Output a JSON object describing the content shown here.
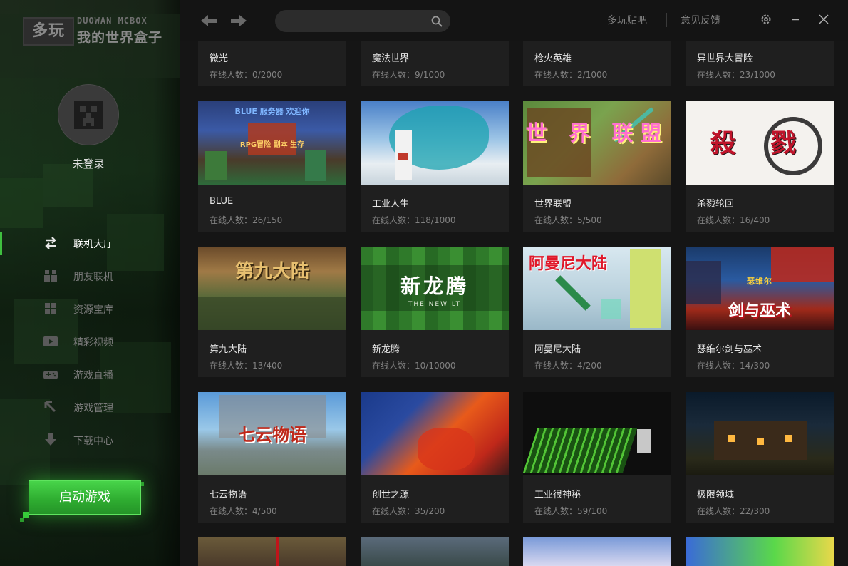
{
  "logo": {
    "mark": "多玩",
    "en": "DUOWAN MCBOX",
    "cn": "我的世界盒子"
  },
  "user": {
    "status": "未登录"
  },
  "nav": {
    "items": [
      {
        "label": "联机大厅",
        "icon": "swap-arrows-icon",
        "active": true
      },
      {
        "label": "朋友联机",
        "icon": "friends-icon",
        "active": false
      },
      {
        "label": "资源宝库",
        "icon": "grid-icon",
        "active": false
      },
      {
        "label": "精彩视频",
        "icon": "video-play-icon",
        "active": false
      },
      {
        "label": "游戏直播",
        "icon": "gamepad-icon",
        "active": false
      },
      {
        "label": "游戏管理",
        "icon": "manage-arrow-icon",
        "active": false
      },
      {
        "label": "下载中心",
        "icon": "download-icon",
        "active": false
      }
    ]
  },
  "launch": {
    "label": "启动游戏"
  },
  "topbar": {
    "search_placeholder": "",
    "link_forum": "多玩贴吧",
    "link_feedback": "意见反馈"
  },
  "servers": {
    "prefix": "在线人数：",
    "top_row": [
      {
        "name": "微光",
        "online": "0/2000"
      },
      {
        "name": "魔法世界",
        "online": "9/1000"
      },
      {
        "name": "枪火英雄",
        "online": "2/1000"
      },
      {
        "name": "异世界大冒险",
        "online": "23/1000"
      }
    ],
    "rows": [
      [
        {
          "name": "BLUE",
          "online": "26/150",
          "art": "BLUE 服务器 欢迎你",
          "art2": "RPG冒险 副本 生存"
        },
        {
          "name": "工业人生",
          "online": "118/1000",
          "art": ""
        },
        {
          "name": "世界联盟",
          "online": "5/500",
          "art": "世 界 联盟"
        },
        {
          "name": "杀戮轮回",
          "online": "16/400",
          "art": "殺 戮"
        }
      ],
      [
        {
          "name": "第九大陆",
          "online": "13/400",
          "art": "第九大陆"
        },
        {
          "name": "新龙腾",
          "online": "10/10000",
          "art": "新龙腾",
          "art2": "THE NEW LT"
        },
        {
          "name": "阿曼尼大陆",
          "online": "4/200",
          "art": "阿曼尼大陆"
        },
        {
          "name": "瑟维尔剑与巫术",
          "online": "14/300",
          "art": "剑与巫术",
          "art2": "瑟维尔"
        }
      ],
      [
        {
          "name": "七云物语",
          "online": "4/500",
          "art": "七云物语"
        },
        {
          "name": "创世之源",
          "online": "35/200",
          "art": ""
        },
        {
          "name": "工业很神秘",
          "online": "59/100",
          "art": ""
        },
        {
          "name": "极限领域",
          "online": "22/300",
          "art": ""
        }
      ]
    ]
  },
  "colors": {
    "accent_green": "#3fbf3f",
    "launch_green": "#2fae31",
    "card_bg": "#1f1f1f",
    "content_bg": "#151515"
  }
}
